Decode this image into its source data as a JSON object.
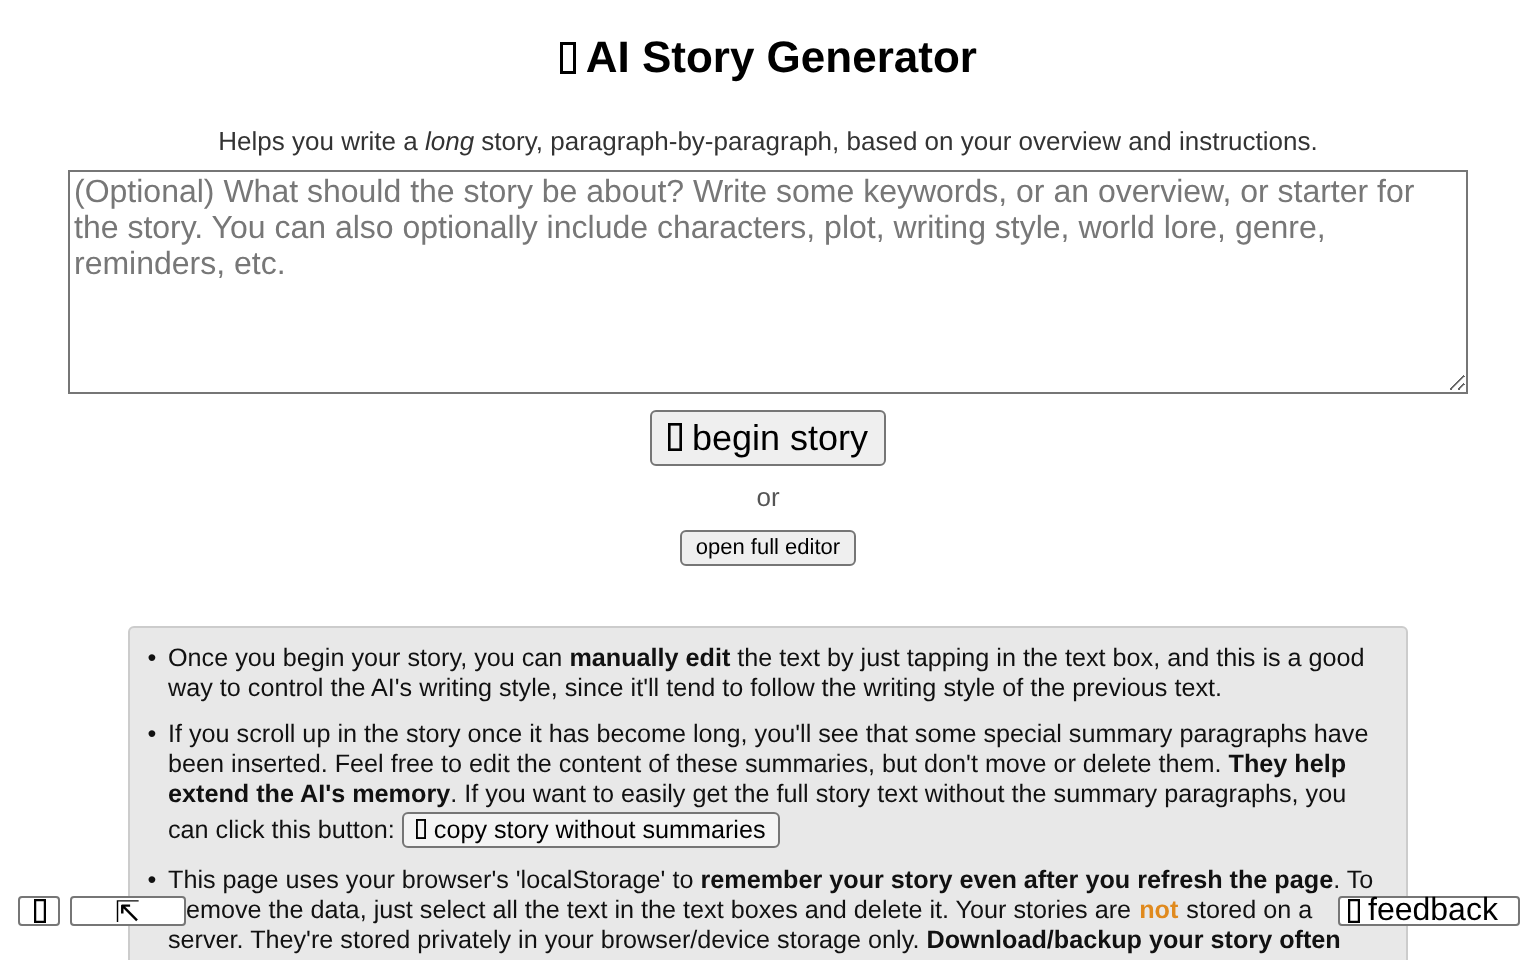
{
  "title": "AI Story Generator",
  "subtitle": "Helps you write a *long* story, paragraph-by-paragraph, based on your overview and instructions.",
  "overview_field": {
    "placeholder": "(Optional) What should the story be about? Write some keywords, or an overview, or starter for the story. You can also optionally include characters, plot, writing style, world lore, genre, reminders, etc."
  },
  "begin_button": "begin story",
  "or_text": "or",
  "editor_button": "open full editor",
  "tips": [
    {
      "marker": "•",
      "lines": [
        [
          {
            "kind": "text",
            "text": "Once you begin your story, you can **manually edit** the text by just tapping in the text box, and this is a good"
          }
        ],
        [
          {
            "kind": "text",
            "text": "way to control the AI's writing style, since it'll tend to follow the writing style of the previous text."
          }
        ]
      ]
    },
    {
      "marker": "•",
      "lines": [
        [
          {
            "kind": "text",
            "text": "If you scroll up in the story once it has become long, you'll see that some special summary paragraphs have"
          }
        ],
        [
          {
            "kind": "text",
            "text": "been inserted. Feel free to edit the content of these summaries, but don't move or delete them. **They help**"
          }
        ],
        [
          {
            "kind": "text",
            "text": "**extend the AI's memory**. If you want to easily get the full story text without the summary paragraphs, you"
          }
        ],
        [
          {
            "kind": "text",
            "text": "can click this button:"
          },
          {
            "kind": "button",
            "text": "copy story without summaries"
          }
        ]
      ]
    },
    {
      "marker": "•",
      "lines": [
        [
          {
            "kind": "text",
            "text": "This page uses your browser's 'localStorage' to **remember your story even after you refresh the page**. To"
          }
        ],
        [
          {
            "kind": "text",
            "text": "emove the data, just select all the text in the text boxes and delete it. Your stories are"
          },
          {
            "kind": "highlight",
            "text": "not"
          },
          {
            "kind": "text",
            "text": "stored on a"
          }
        ],
        [
          {
            "kind": "text",
            "text": "server. They're stored privately in your browser/device storage only. **Download/backup your story often**"
          }
        ]
      ]
    }
  ],
  "corner_buttons": [
    {
      "kind": "glyph"
    },
    {
      "kind": "arrow",
      "text": "⇱"
    }
  ],
  "feedback_button": "feedback"
}
